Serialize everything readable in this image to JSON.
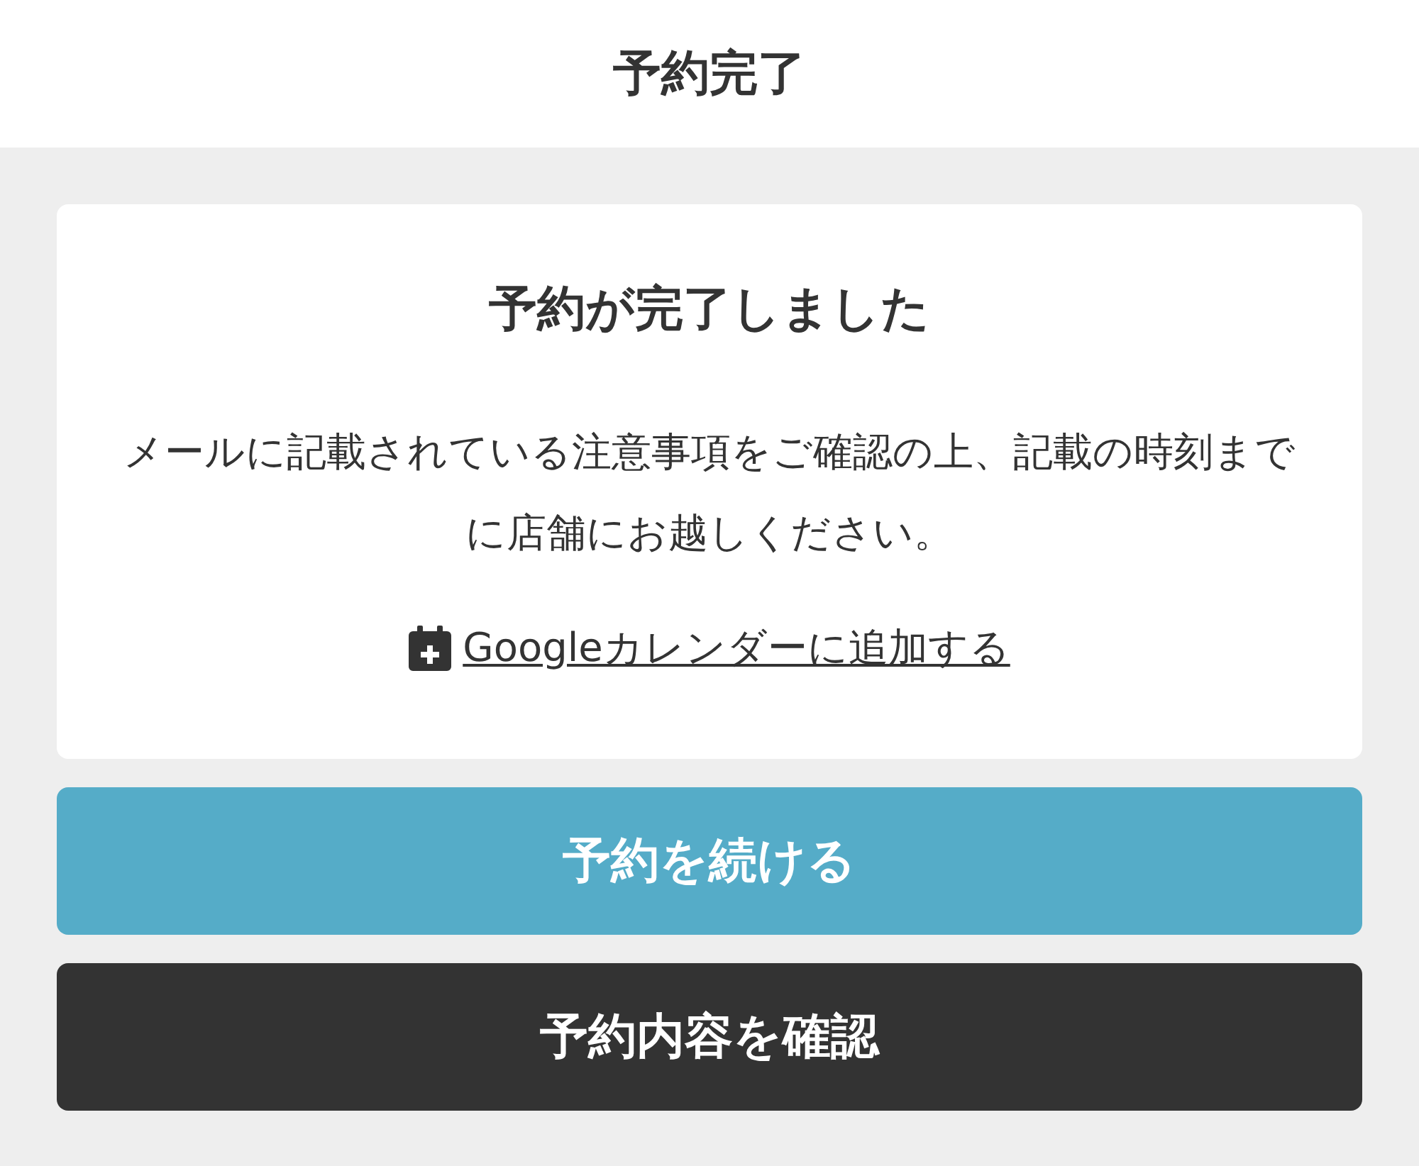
{
  "header": {
    "title": "予約完了"
  },
  "card": {
    "heading": "予約が完了しました",
    "message": "メールに記載されている注意事項をご確認の上、記載の時刻までに店舗にお越しください。",
    "calendar_link": "Googleカレンダーに追加する"
  },
  "buttons": [
    {
      "label": "予約を続ける",
      "kind": "primary"
    },
    {
      "label": "予約内容を確認",
      "kind": "dark"
    }
  ]
}
